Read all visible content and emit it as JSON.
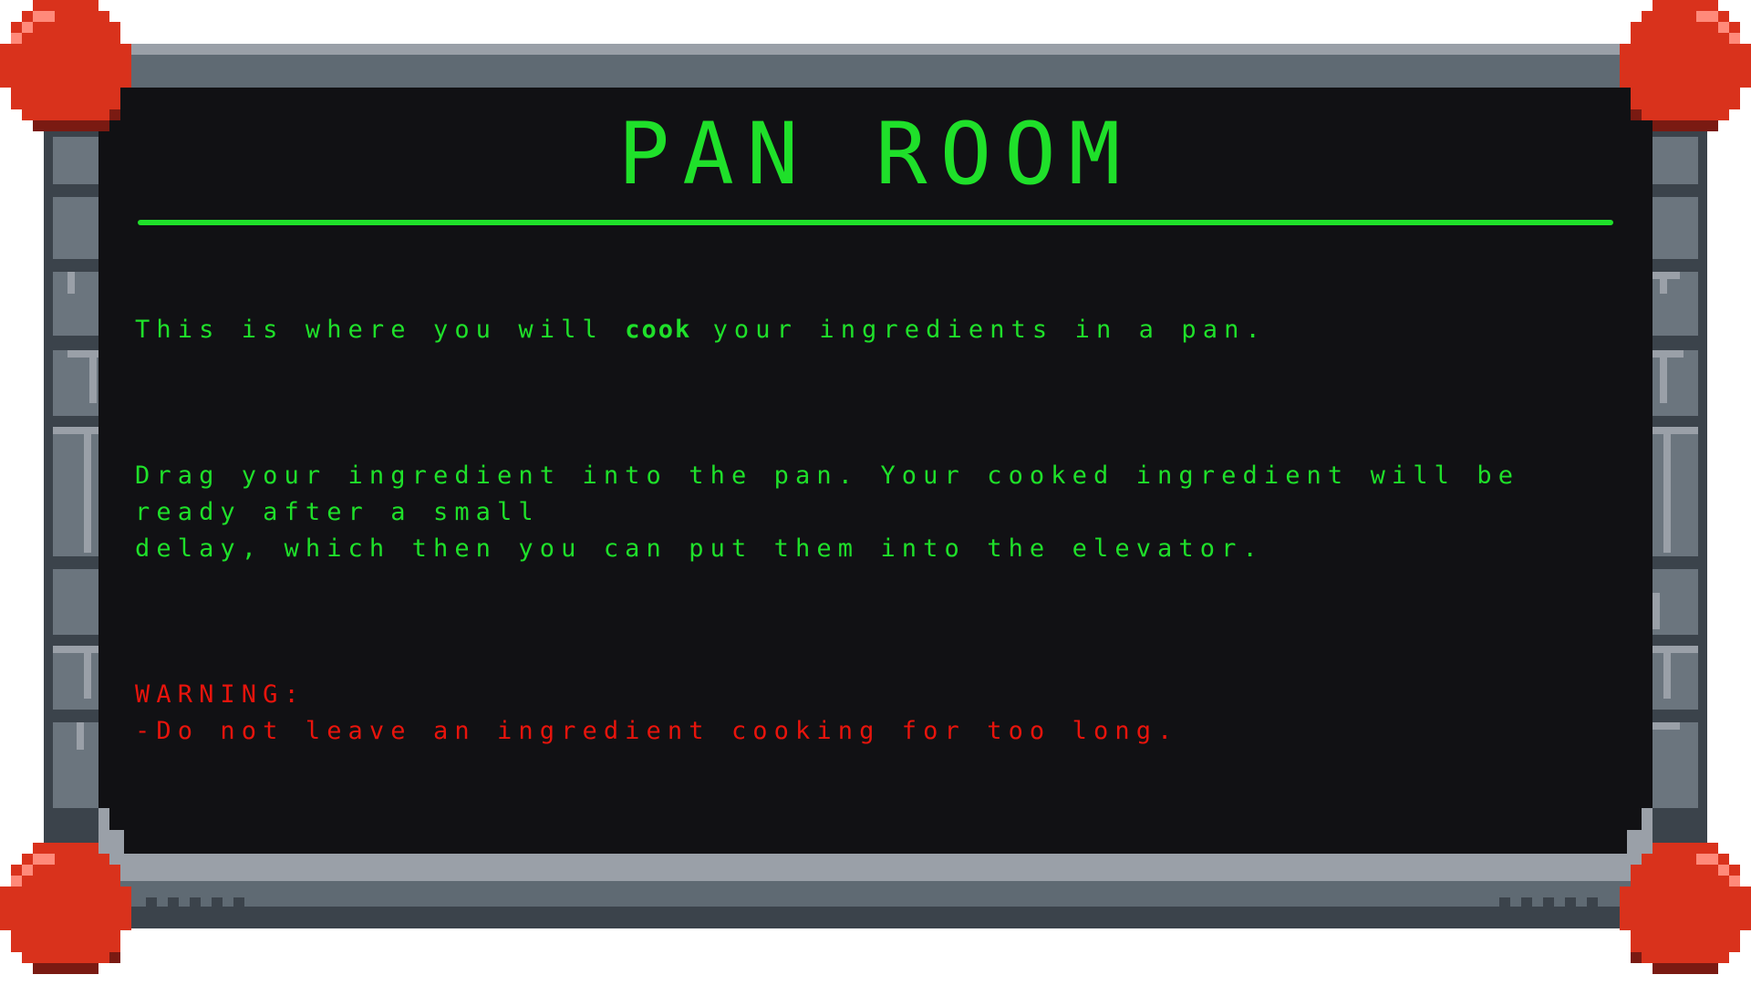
{
  "screen": {
    "title": "PAN ROOM",
    "intro": {
      "before": "This is where you will ",
      "highlight": "cook",
      "after": " your ingredients in a pan."
    },
    "instructions": {
      "line1": "Drag your ingredient into the pan. Your cooked ingredient will be ready after a small",
      "line2": "delay, which then you can put them into the elevator."
    },
    "warning": {
      "heading": "WARNING:",
      "item": "-Do not leave an ingredient cooking for too long."
    }
  },
  "colors": {
    "text_green": "#1fe02a",
    "warning_red": "#e8140c",
    "screen_bg": "#111114",
    "frame_light": "#9aa0a8",
    "frame_mid": "#5f6a73",
    "frame_dark": "#3b434b",
    "bolt_red": "#d9321c",
    "bolt_highlight": "#ff8a7a",
    "bolt_shadow": "#7a1a12"
  }
}
